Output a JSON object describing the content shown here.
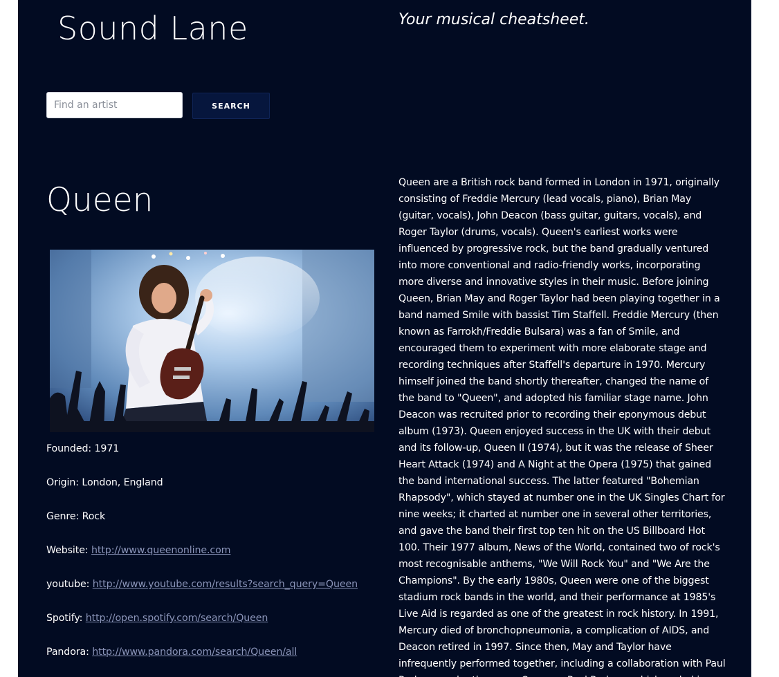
{
  "header": {
    "brand": "Sound Lane",
    "tagline": "Your musical cheatsheet."
  },
  "search": {
    "placeholder": "Find an artist",
    "value": "",
    "button_label": "SEARCH"
  },
  "artist": {
    "name": "Queen",
    "photo_icon": "band-photo-guitarist-on-stage",
    "facts": [
      {
        "label": "Founded:",
        "value": "1971"
      },
      {
        "label": "Origin:",
        "value": "London, England"
      },
      {
        "label": "Genre:",
        "value": "Rock"
      }
    ],
    "links": [
      {
        "label": "Website:",
        "url": "http://www.queenonline.com"
      },
      {
        "label": "youtube:",
        "url": "http://www.youtube.com/results?search_query=Queen"
      },
      {
        "label": "Spotify:",
        "url": "http://open.spotify.com/search/Queen"
      },
      {
        "label": "Pandora:",
        "url": "http://www.pandora.com/search/Queen/all"
      }
    ],
    "bio": "Queen are a British rock band formed in London in 1971, originally consisting of Freddie Mercury (lead vocals, piano), Brian May (guitar, vocals), John Deacon (bass guitar, guitars, vocals), and Roger Taylor (drums, vocals). Queen's earliest works were influenced by progressive rock, but the band gradually ventured into more conventional and radio-friendly works, incorporating more diverse and innovative styles in their music. Before joining Queen, Brian May and Roger Taylor had been playing together in a band named Smile with bassist Tim Staffell. Freddie Mercury (then known as Farrokh/Freddie Bulsara) was a fan of Smile, and encouraged them to experiment with more elaborate stage and recording techniques after Staffell's departure in 1970. Mercury himself joined the band shortly thereafter, changed the name of the band to \"Queen\", and adopted his familiar stage name. John Deacon was recruited prior to recording their eponymous debut album (1973). Queen enjoyed success in the UK with their debut and its follow-up, Queen II (1974), but it was the release of Sheer Heart Attack (1974) and A Night at the Opera (1975) that gained the band international success. The latter featured \"Bohemian Rhapsody\", which stayed at number one in the UK Singles Chart for nine weeks; it charted at number one in several other territories, and gave the band their first top ten hit on the US Billboard Hot 100. Their 1977 album, News of the World, contained two of rock's most recognisable anthems, \"We Will Rock You\" and \"We Are the Champions\". By the early 1980s, Queen were one of the biggest stadium rock bands in the world, and their performance at 1985's Live Aid is regarded as one of the greatest in rock history. In 1991, Mercury died of bronchopneumonia, a complication of AIDS, and Deacon retired in 1997. Since then, May and Taylor have infrequently performed together, including a collaboration with Paul Rodgers under the name Queen + Paul Rodgers which ended in May..."
  },
  "colors": {
    "page_background": "#020b22",
    "button_background": "#06163d",
    "link": "#8a94b8",
    "text": "#ffffff"
  }
}
